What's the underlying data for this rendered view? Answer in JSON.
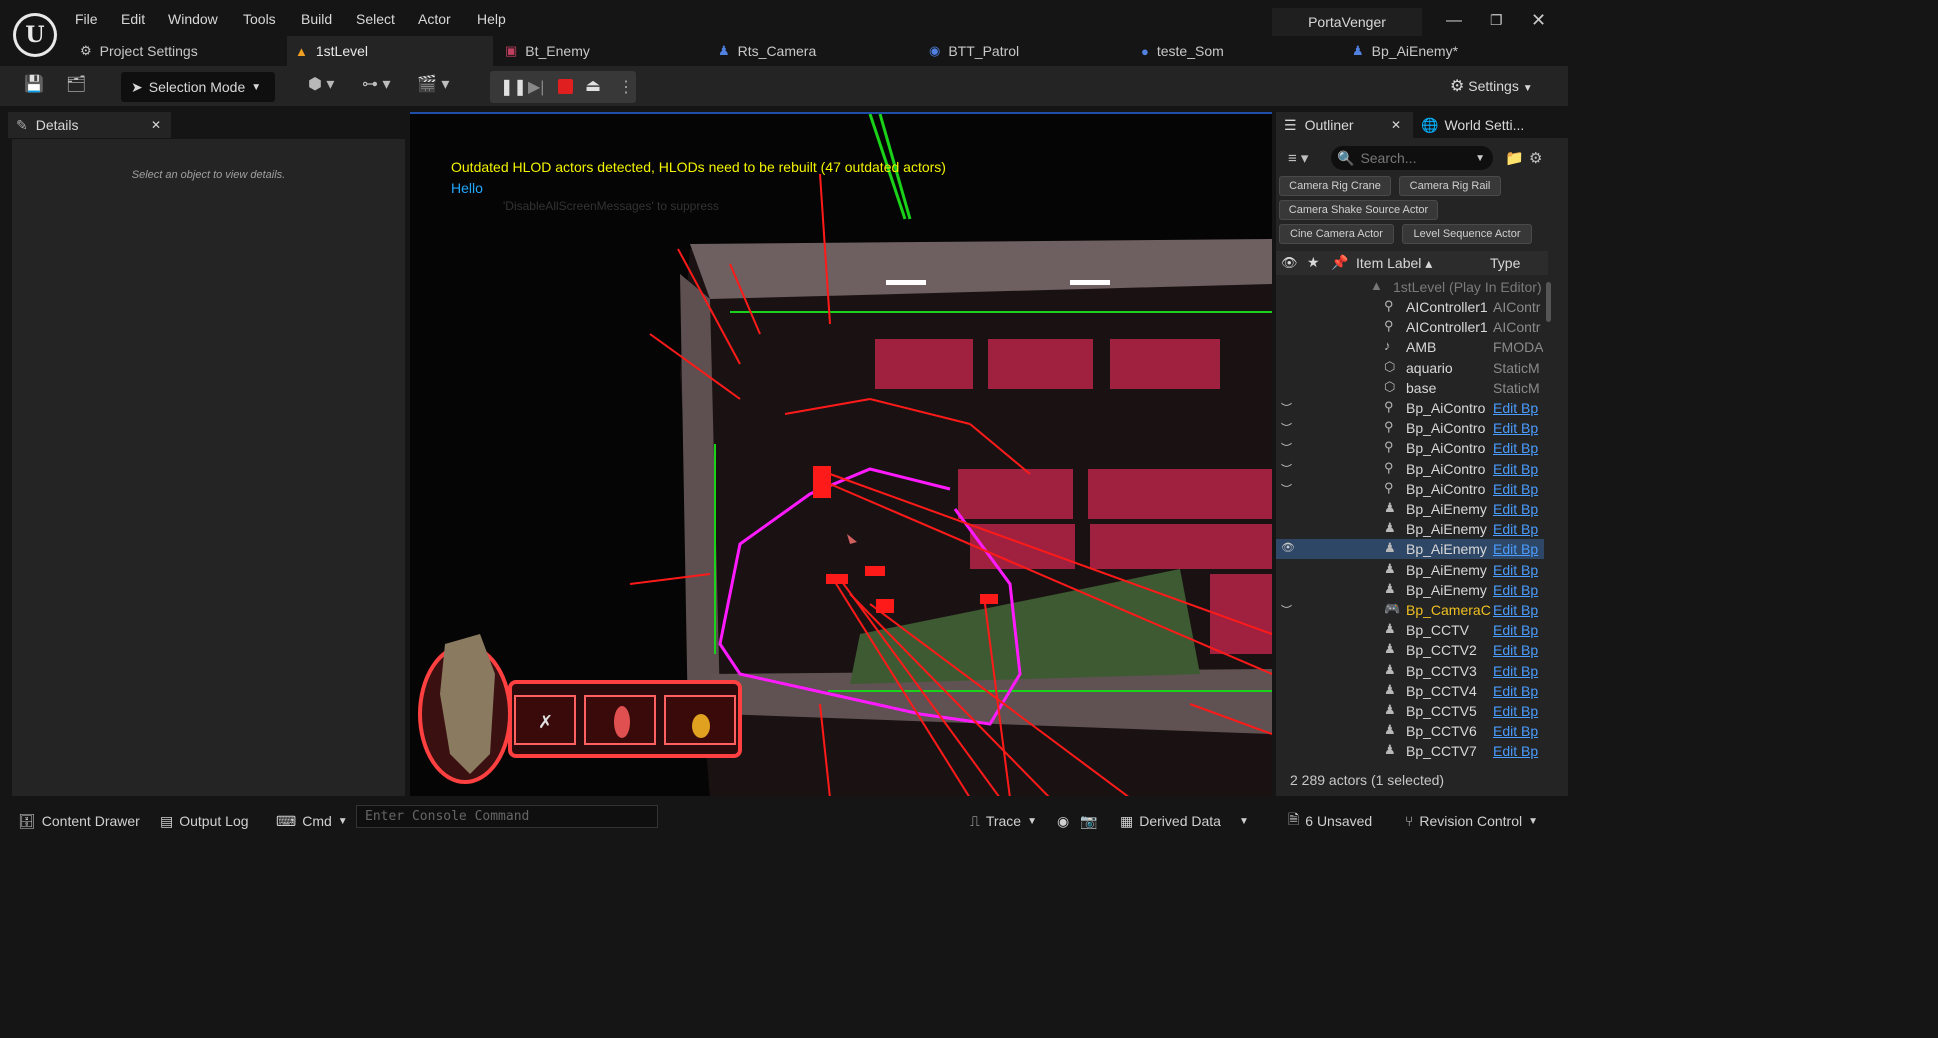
{
  "menu": [
    "File",
    "Edit",
    "Window",
    "Tools",
    "Build",
    "Select",
    "Actor",
    "Help"
  ],
  "project_name": "PortaVenger",
  "tabs": [
    {
      "label": "Project Settings",
      "icon": "gear"
    },
    {
      "label": "1stLevel",
      "icon": "level"
    },
    {
      "label": "Bt_Enemy",
      "icon": "behavior-tree"
    },
    {
      "label": "Rts_Camera",
      "icon": "pawn"
    },
    {
      "label": "BTT_Patrol",
      "icon": "task"
    },
    {
      "label": "teste_Som",
      "icon": "blueprint"
    },
    {
      "label": "Bp_AiEnemy*",
      "icon": "pawn"
    }
  ],
  "toolbar": {
    "selection_mode": "Selection Mode",
    "settings": "Settings"
  },
  "details": {
    "tab_label": "Details",
    "hint": "Select an object to view details."
  },
  "viewport": {
    "hlod_message": "Outdated HLOD actors detected, HLODs need to be rebuilt (47 outdated actors)",
    "hello_message": "Hello",
    "ghost_message": "'DisableAllScreenMessages' to suppress"
  },
  "outliner": {
    "tab_label": "Outliner",
    "world_tab_label": "World Setti...",
    "search_placeholder": "Search...",
    "chips": [
      "Camera Rig Crane",
      "Camera Rig Rail",
      "Camera Shake Source Actor",
      "Cine Camera Actor",
      "Level Sequence Actor"
    ],
    "col_label": "Item Label",
    "col_type": "Type",
    "level_row": "1stLevel (Play In Editor)",
    "rows": [
      {
        "label": "AIController1",
        "type": "AIContr",
        "icon": "ai",
        "vis": ""
      },
      {
        "label": "AIController1",
        "type": "AIContr",
        "icon": "ai",
        "vis": ""
      },
      {
        "label": "AMB",
        "type": "FMODA",
        "icon": "sound",
        "vis": ""
      },
      {
        "label": "aquario",
        "type": "StaticM",
        "icon": "mesh",
        "vis": ""
      },
      {
        "label": "base",
        "type": "StaticM",
        "icon": "mesh",
        "vis": ""
      },
      {
        "label": "Bp_AiContro",
        "type": "Edit Bp",
        "icon": "ai",
        "vis": "hidden"
      },
      {
        "label": "Bp_AiContro",
        "type": "Edit Bp",
        "icon": "ai",
        "vis": "hidden"
      },
      {
        "label": "Bp_AiContro",
        "type": "Edit Bp",
        "icon": "ai",
        "vis": "hidden"
      },
      {
        "label": "Bp_AiContro",
        "type": "Edit Bp",
        "icon": "ai",
        "vis": "hidden"
      },
      {
        "label": "Bp_AiContro",
        "type": "Edit Bp",
        "icon": "ai",
        "vis": "hidden"
      },
      {
        "label": "Bp_AiEnemy",
        "type": "Edit Bp",
        "icon": "pawn",
        "vis": ""
      },
      {
        "label": "Bp_AiEnemy",
        "type": "Edit Bp",
        "icon": "pawn",
        "vis": ""
      },
      {
        "label": "Bp_AiEnemy",
        "type": "Edit Bp",
        "icon": "pawn",
        "vis": "shown",
        "selected": true
      },
      {
        "label": "Bp_AiEnemy",
        "type": "Edit Bp",
        "icon": "pawn",
        "vis": ""
      },
      {
        "label": "Bp_AiEnemy",
        "type": "Edit Bp",
        "icon": "pawn",
        "vis": ""
      },
      {
        "label": "Bp_CameraC",
        "type": "Edit Bp",
        "icon": "gamepad",
        "vis": "hidden",
        "highlight": true
      },
      {
        "label": "Bp_CCTV",
        "type": "Edit Bp",
        "icon": "pawn",
        "vis": ""
      },
      {
        "label": "Bp_CCTV2",
        "type": "Edit Bp",
        "icon": "pawn",
        "vis": ""
      },
      {
        "label": "Bp_CCTV3",
        "type": "Edit Bp",
        "icon": "pawn",
        "vis": ""
      },
      {
        "label": "Bp_CCTV4",
        "type": "Edit Bp",
        "icon": "pawn",
        "vis": ""
      },
      {
        "label": "Bp_CCTV5",
        "type": "Edit Bp",
        "icon": "pawn",
        "vis": ""
      },
      {
        "label": "Bp_CCTV6",
        "type": "Edit Bp",
        "icon": "pawn",
        "vis": ""
      },
      {
        "label": "Bp_CCTV7",
        "type": "Edit Bp",
        "icon": "pawn",
        "vis": ""
      }
    ],
    "actor_count": "2 289 actors (1 selected)"
  },
  "statusbar": {
    "content_drawer": "Content Drawer",
    "output_log": "Output Log",
    "cmd": "Cmd",
    "console_placeholder": "Enter Console Command",
    "trace": "Trace",
    "derived_data": "Derived Data",
    "unsaved": "6 Unsaved",
    "revision_control": "Revision Control"
  },
  "colors": {
    "accent": "#1f4fa8",
    "link": "#4a9cff",
    "hlod_text": "#f4f400",
    "hello_text": "#22a7ff",
    "debug_red": "#ff1a1a",
    "debug_magenta": "#ff1aff",
    "debug_green": "#19d219"
  }
}
